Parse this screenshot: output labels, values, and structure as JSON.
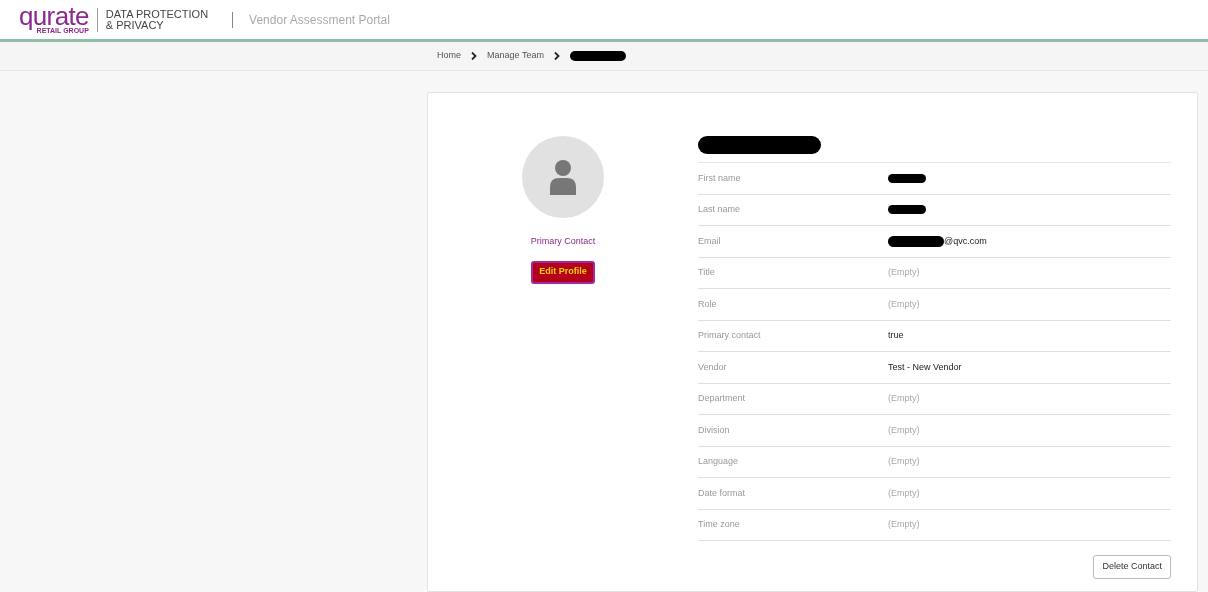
{
  "header": {
    "logo": {
      "wordmark": "qurate",
      "tagline": "RETAIL GROUP"
    },
    "division": [
      "DATA PROTECTION",
      "& PRIVACY"
    ],
    "portal": "Vendor Assessment Portal"
  },
  "breadcrumb": [
    {
      "label": "Home",
      "redacted": false
    },
    {
      "label": "Manage Team",
      "redacted": false
    },
    {
      "redacted": true
    }
  ],
  "profile": {
    "badge": "Primary Contact",
    "edit_button": "Edit Profile",
    "name_redacted": true
  },
  "fields": [
    {
      "label": "First name",
      "kind": "redacted"
    },
    {
      "label": "Last name",
      "kind": "redacted"
    },
    {
      "label": "Email",
      "kind": "redacted",
      "value": "@qvc.com"
    },
    {
      "label": "Title",
      "kind": "empty",
      "value": "(Empty)"
    },
    {
      "label": "Role",
      "kind": "empty",
      "value": "(Empty)"
    },
    {
      "label": "Primary contact",
      "kind": "text",
      "value": "true"
    },
    {
      "label": "Vendor",
      "kind": "text",
      "value": "Test - New Vendor"
    },
    {
      "label": "Department",
      "kind": "empty",
      "value": "(Empty)"
    },
    {
      "label": "Division",
      "kind": "empty",
      "value": "(Empty)"
    },
    {
      "label": "Language",
      "kind": "empty",
      "value": "(Empty)"
    },
    {
      "label": "Date format",
      "kind": "empty",
      "value": "(Empty)"
    },
    {
      "label": "Time zone",
      "kind": "empty",
      "value": "(Empty)"
    }
  ],
  "delete_button": "Delete Contact"
}
